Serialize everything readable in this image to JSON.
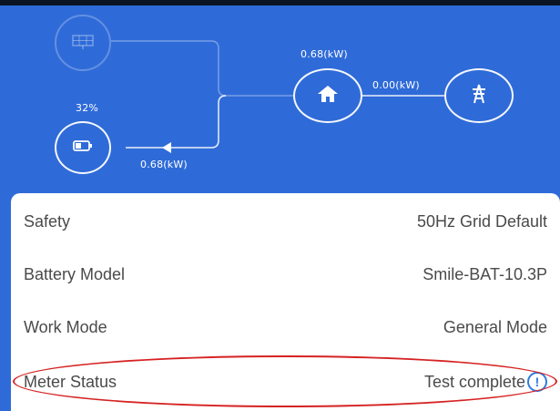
{
  "energy_flow": {
    "battery_soc": "32%",
    "home_power": "0.68(kW)",
    "grid_power": "0.00(kW)",
    "battery_power": "0.68(kW)"
  },
  "icons": {
    "solar": "solar-panel-icon",
    "battery": "battery-icon",
    "home": "home-icon",
    "grid": "power-tower-icon",
    "info": "info-icon"
  },
  "info_icon_glyph": "!",
  "settings": [
    {
      "label": "Safety",
      "value": "50Hz Grid Default"
    },
    {
      "label": "Battery Model",
      "value": "Smile-BAT-10.3P"
    },
    {
      "label": "Work Mode",
      "value": "General Mode"
    },
    {
      "label": "Meter Status",
      "value": "Test complete"
    }
  ],
  "colors": {
    "header_blue": "#2f6bd8",
    "highlight": "#d62222",
    "info": "#2d7be0"
  }
}
